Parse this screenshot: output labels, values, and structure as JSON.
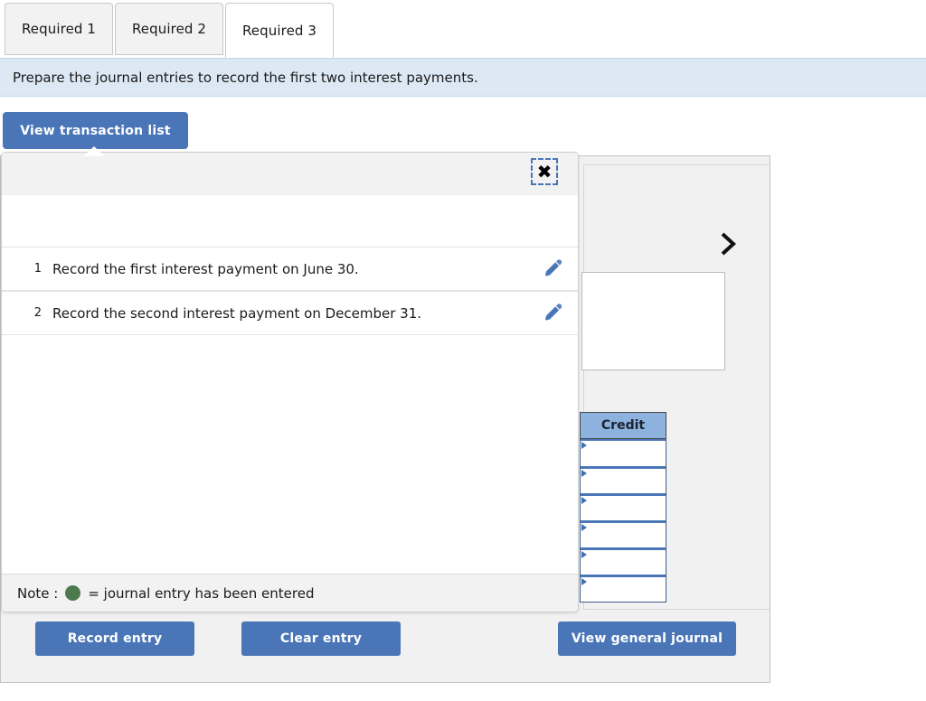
{
  "tabs": [
    {
      "label": "Required 1",
      "active": false
    },
    {
      "label": "Required 2",
      "active": false
    },
    {
      "label": "Required 3",
      "active": true
    }
  ],
  "instruction": "Prepare the journal entries to record the first two interest payments.",
  "view_transaction_list_button": "View transaction list",
  "popup": {
    "close_icon": "close-icon",
    "transactions": [
      {
        "num": "1",
        "text": "Record the first interest payment on June 30.",
        "edit_icon": "pencil-icon"
      },
      {
        "num": "2",
        "text": "Record the second interest payment on December 31.",
        "edit_icon": "pencil-icon"
      }
    ],
    "note_prefix": "Note :",
    "note_suffix": "= journal entry has been entered",
    "note_dot_color": "#4c7a4c"
  },
  "journal": {
    "chevron_icon": "chevron-right-icon",
    "credit_header": "Credit",
    "credit_rows": [
      "",
      "",
      "",
      "",
      "",
      ""
    ]
  },
  "actions": {
    "record_entry": "Record entry",
    "clear_entry": "Clear entry",
    "view_general_journal": "View general journal"
  },
  "colors": {
    "accent_blue": "#4a76b8",
    "instruction_bg": "#dce9f5",
    "credit_header_bg": "#8cb2dd",
    "panel_bg": "#f1f1f1"
  }
}
